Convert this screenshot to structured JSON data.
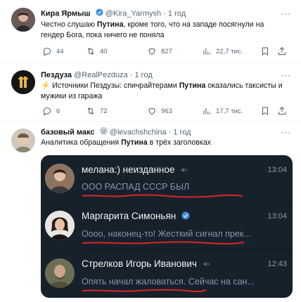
{
  "tweets": [
    {
      "display_name": "Кира Ярмыш",
      "handle": "@Kira_Yarmysh",
      "dot": "·",
      "time": "1 год",
      "text_parts": [
        "Честно слушаю ",
        "Путина",
        ", кроме того, что на западе посягнули на гендер Бога, пока ничего не поняла"
      ],
      "stats": {
        "replies": "44",
        "retweets": "40",
        "likes": "827",
        "views": "22,7 тис."
      }
    },
    {
      "display_name": "Пездуза",
      "handle": "@RealPezduza",
      "dot": "·",
      "time": "1 год",
      "text_parts": [
        "⚡️ Источники Пездузы: спичрайтерами ",
        "Путина",
        " оказались таксисты и мужики из гаража"
      ],
      "stats": {
        "replies": "6",
        "retweets": "72",
        "likes": "963",
        "views": "17,7 тис."
      }
    },
    {
      "display_name": "базовый макс",
      "handle": "@levachshchina",
      "dot": "·",
      "time": "1 год",
      "text_parts": [
        "Аналитика обращения ",
        "Путина",
        " в трёх заголовках"
      ],
      "embedded_chats": [
        {
          "name": "мелана:) неизданное",
          "time": "13:04",
          "message": "ООО РАСПАД СССР БЫЛ",
          "muted": true
        },
        {
          "name": "Маргарита Симоньян",
          "time": "13:04",
          "message": "Оооо, наконец-то! Жесткий сигнал прек...",
          "verified": true
        },
        {
          "name": "Стрелков Игорь Иванович",
          "time": "12:43",
          "message": "Опять начал жаловаться. Сейчас на сан...",
          "muted": true
        }
      ]
    }
  ],
  "icons": {
    "reply": "reply-icon",
    "retweet": "retweet-icon",
    "like": "heart-icon",
    "views": "views-icon",
    "bookmark": "bookmark-icon",
    "share": "share-icon",
    "more": "more-icon",
    "mute": "muted-icon",
    "verified": "verified-icon",
    "emoji": "face-emoji-icon"
  },
  "colors": {
    "text": "#0f1419",
    "grey": "#536471",
    "telegram_bg": "#17212b",
    "underline": "#d9262a",
    "verified": "#3e8ee0"
  }
}
